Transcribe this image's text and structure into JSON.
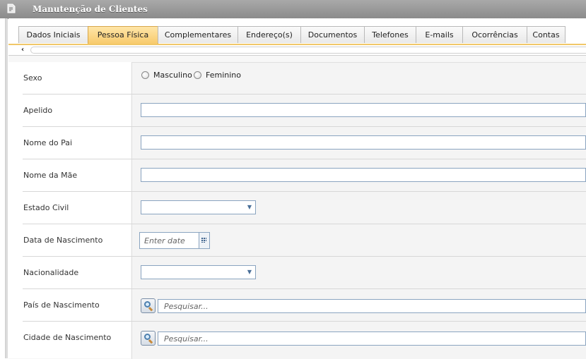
{
  "window": {
    "title": "Manutenção de Clientes",
    "icon": "document-icon"
  },
  "tabs": [
    {
      "label": "Dados Iniciais",
      "active": false
    },
    {
      "label": "Pessoa Física",
      "active": true
    },
    {
      "label": "Complementares",
      "active": false
    },
    {
      "label": "Endereço(s)",
      "active": false
    },
    {
      "label": "Documentos",
      "active": false
    },
    {
      "label": "Telefones",
      "active": false
    },
    {
      "label": "E-mails",
      "active": false
    },
    {
      "label": "Ocorrências",
      "active": false
    },
    {
      "label": "Contas",
      "active": false
    }
  ],
  "form": {
    "sexo": {
      "label": "Sexo",
      "options": [
        "Masculino",
        "Feminino"
      ],
      "selected": null
    },
    "apelido": {
      "label": "Apelido",
      "value": ""
    },
    "nome_pai": {
      "label": "Nome do Pai",
      "value": ""
    },
    "nome_mae": {
      "label": "Nome da Mãe",
      "value": ""
    },
    "estado_civil": {
      "label": "Estado Civil",
      "value": ""
    },
    "data_nascimento": {
      "label": "Data de Nascimento",
      "placeholder": "Enter date"
    },
    "nacionalidade": {
      "label": "Nacionalidade",
      "value": ""
    },
    "pais_nascimento": {
      "label": "País de Nascimento",
      "placeholder": "Pesquisar..."
    },
    "cidade_nascimento": {
      "label": "Cidade de Nascimento",
      "placeholder": "Pesquisar..."
    }
  },
  "colors": {
    "active_tab": "#f7c96a",
    "input_border": "#8aa4c0",
    "titlebar": "#8b8b8b"
  }
}
